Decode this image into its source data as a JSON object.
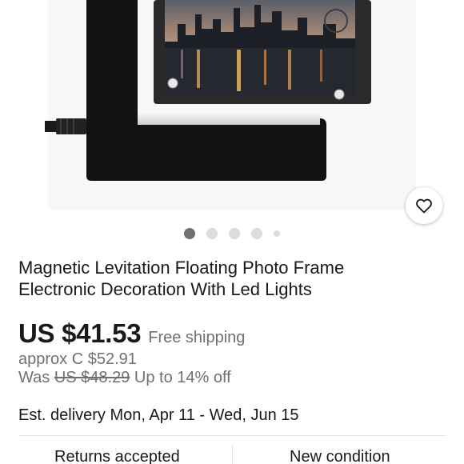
{
  "product": {
    "image_alt": "Magnetic levitation floating photo frame",
    "carousel": {
      "count": 5,
      "active_index": 0
    },
    "title_line1": "Magnetic Levitation Floating Photo Frame",
    "title_line2": "Electronic Decoration With Led Lights"
  },
  "pricing": {
    "price": "US $41.53",
    "shipping": "Free shipping",
    "approx": "approx C $52.91",
    "was_label": "Was",
    "was_price": "US $48.29",
    "discount": "Up to 14% off"
  },
  "delivery": {
    "estimate": "Est. delivery Mon, Apr 11 - Wed, Jun 15"
  },
  "features": {
    "left": "Returns accepted",
    "right": "New condition"
  },
  "icons": {
    "favorite": "heart-outline-icon"
  },
  "colors": {
    "text": "#191919",
    "muted": "#707070",
    "dot_active": "#707070",
    "dot_inactive": "#dcdcdc"
  }
}
